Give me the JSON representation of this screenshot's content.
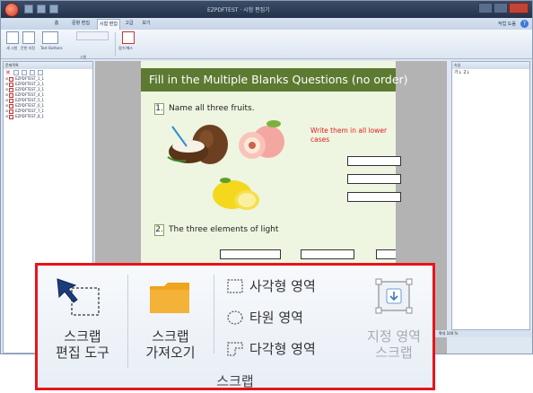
{
  "window": {
    "title": "EZPDFTEST · 시험 편집기"
  },
  "tabs": [
    "홈",
    "문항 편집",
    "시험 편집",
    "고급",
    "보기"
  ],
  "active_tab_index": 2,
  "help_link": "작업 도움",
  "ribbon": {
    "buttons": [
      "새 시험",
      "문항 지정",
      "Test Buttons",
      "점수/패스"
    ],
    "group_label": "시험"
  },
  "left_pane": {
    "title": "문제목록",
    "items": [
      "EZPDFTEST_1_1",
      "EZPDFTEST_2_1",
      "EZPDFTEST_3_1",
      "EZPDFTEST_4_1",
      "EZPDFTEST_5_1",
      "EZPDFTEST_6_1",
      "EZPDFTEST_7_1",
      "EZPDFTEST_8_1"
    ]
  },
  "right_pane": {
    "title": "속성",
    "sort_icons": "가↓ 2↓"
  },
  "status_bar": {
    "zoom": "확대 100 %"
  },
  "page": {
    "header": "Fill in the Multiple Blanks Questions (no order)",
    "q1_number": "1.",
    "q1_text": "Name all three fruits.",
    "hint": "Write them in all lower cases",
    "q2_number": "2.",
    "q2_text": "The three elements of light"
  },
  "callout": {
    "edit_label": "스크랩\n편집 도구",
    "import_label": "스크랩\n가져오기",
    "rect_label": "사각형 영역",
    "ellipse_label": "타원 영역",
    "polygon_label": "다각형 영역",
    "designated_label": "지정 영역\n스크랩",
    "group_label": "스크랩",
    "accent_color": "#e8141a",
    "folder_color": "#f0a31c"
  }
}
